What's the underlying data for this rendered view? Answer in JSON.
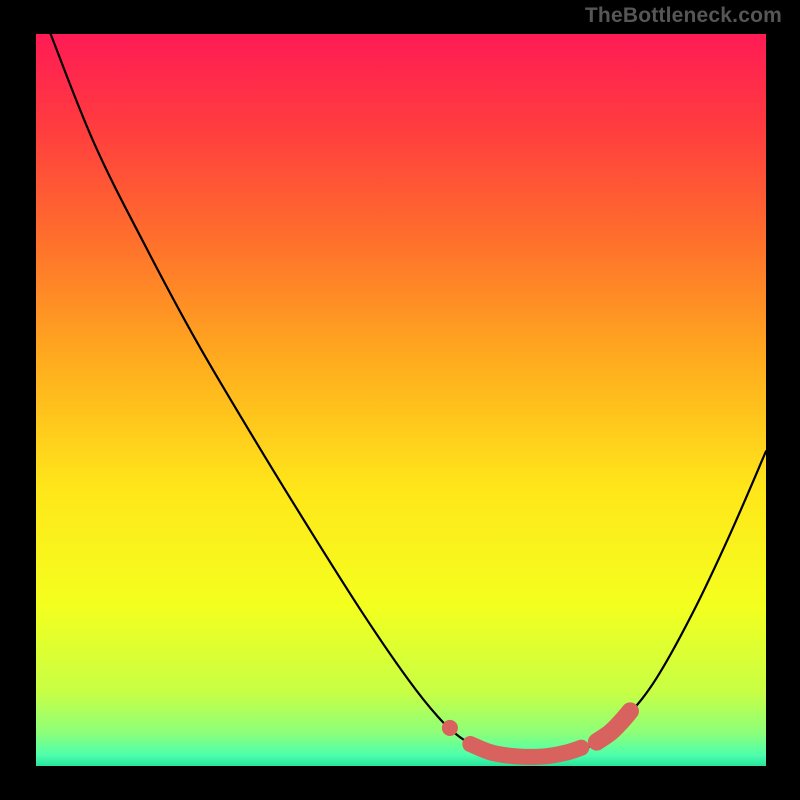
{
  "attribution": "TheBottleneck.com",
  "chart_data": {
    "type": "line",
    "title": "",
    "xlabel": "",
    "ylabel": "",
    "xlim": [
      0,
      100
    ],
    "ylim": [
      0,
      100
    ],
    "background_gradient": {
      "stops": [
        {
          "offset": 0.0,
          "color": "#ff1b55"
        },
        {
          "offset": 0.12,
          "color": "#ff3a40"
        },
        {
          "offset": 0.28,
          "color": "#ff6f2c"
        },
        {
          "offset": 0.45,
          "color": "#ffad1e"
        },
        {
          "offset": 0.62,
          "color": "#ffe61a"
        },
        {
          "offset": 0.78,
          "color": "#f4ff1e"
        },
        {
          "offset": 0.9,
          "color": "#c7ff45"
        },
        {
          "offset": 0.955,
          "color": "#8cff7a"
        },
        {
          "offset": 0.985,
          "color": "#4dffad"
        },
        {
          "offset": 1.0,
          "color": "#27e49a"
        }
      ]
    },
    "curve": [
      {
        "x": 2.0,
        "y": 100.0
      },
      {
        "x": 8.0,
        "y": 85.0
      },
      {
        "x": 15.0,
        "y": 71.0
      },
      {
        "x": 22.0,
        "y": 58.0
      },
      {
        "x": 30.0,
        "y": 44.5
      },
      {
        "x": 38.0,
        "y": 31.5
      },
      {
        "x": 45.0,
        "y": 20.5
      },
      {
        "x": 51.0,
        "y": 11.8
      },
      {
        "x": 55.0,
        "y": 6.8
      },
      {
        "x": 58.0,
        "y": 4.0
      },
      {
        "x": 61.0,
        "y": 2.3
      },
      {
        "x": 64.5,
        "y": 1.4
      },
      {
        "x": 68.0,
        "y": 1.2
      },
      {
        "x": 71.5,
        "y": 1.4
      },
      {
        "x": 75.0,
        "y": 2.3
      },
      {
        "x": 78.0,
        "y": 4.0
      },
      {
        "x": 81.0,
        "y": 6.8
      },
      {
        "x": 85.0,
        "y": 12.0
      },
      {
        "x": 90.0,
        "y": 21.0
      },
      {
        "x": 95.0,
        "y": 31.5
      },
      {
        "x": 100.0,
        "y": 43.0
      }
    ],
    "highlight_segments": [
      {
        "type": "dot",
        "x": 56.7,
        "y": 5.2,
        "r": 1.1
      },
      {
        "type": "stroke",
        "points": [
          {
            "x": 59.5,
            "y": 3.0
          },
          {
            "x": 62.5,
            "y": 1.8
          },
          {
            "x": 66.0,
            "y": 1.3
          },
          {
            "x": 69.5,
            "y": 1.3
          },
          {
            "x": 72.5,
            "y": 1.8
          },
          {
            "x": 74.7,
            "y": 2.5
          }
        ],
        "width": 2.2
      },
      {
        "type": "stroke",
        "points": [
          {
            "x": 76.8,
            "y": 3.3
          },
          {
            "x": 78.7,
            "y": 4.6
          },
          {
            "x": 80.2,
            "y": 6.1
          },
          {
            "x": 81.4,
            "y": 7.5
          }
        ],
        "width": 2.4
      }
    ],
    "colors": {
      "curve": "#000000",
      "highlight": "#d8635e"
    }
  }
}
